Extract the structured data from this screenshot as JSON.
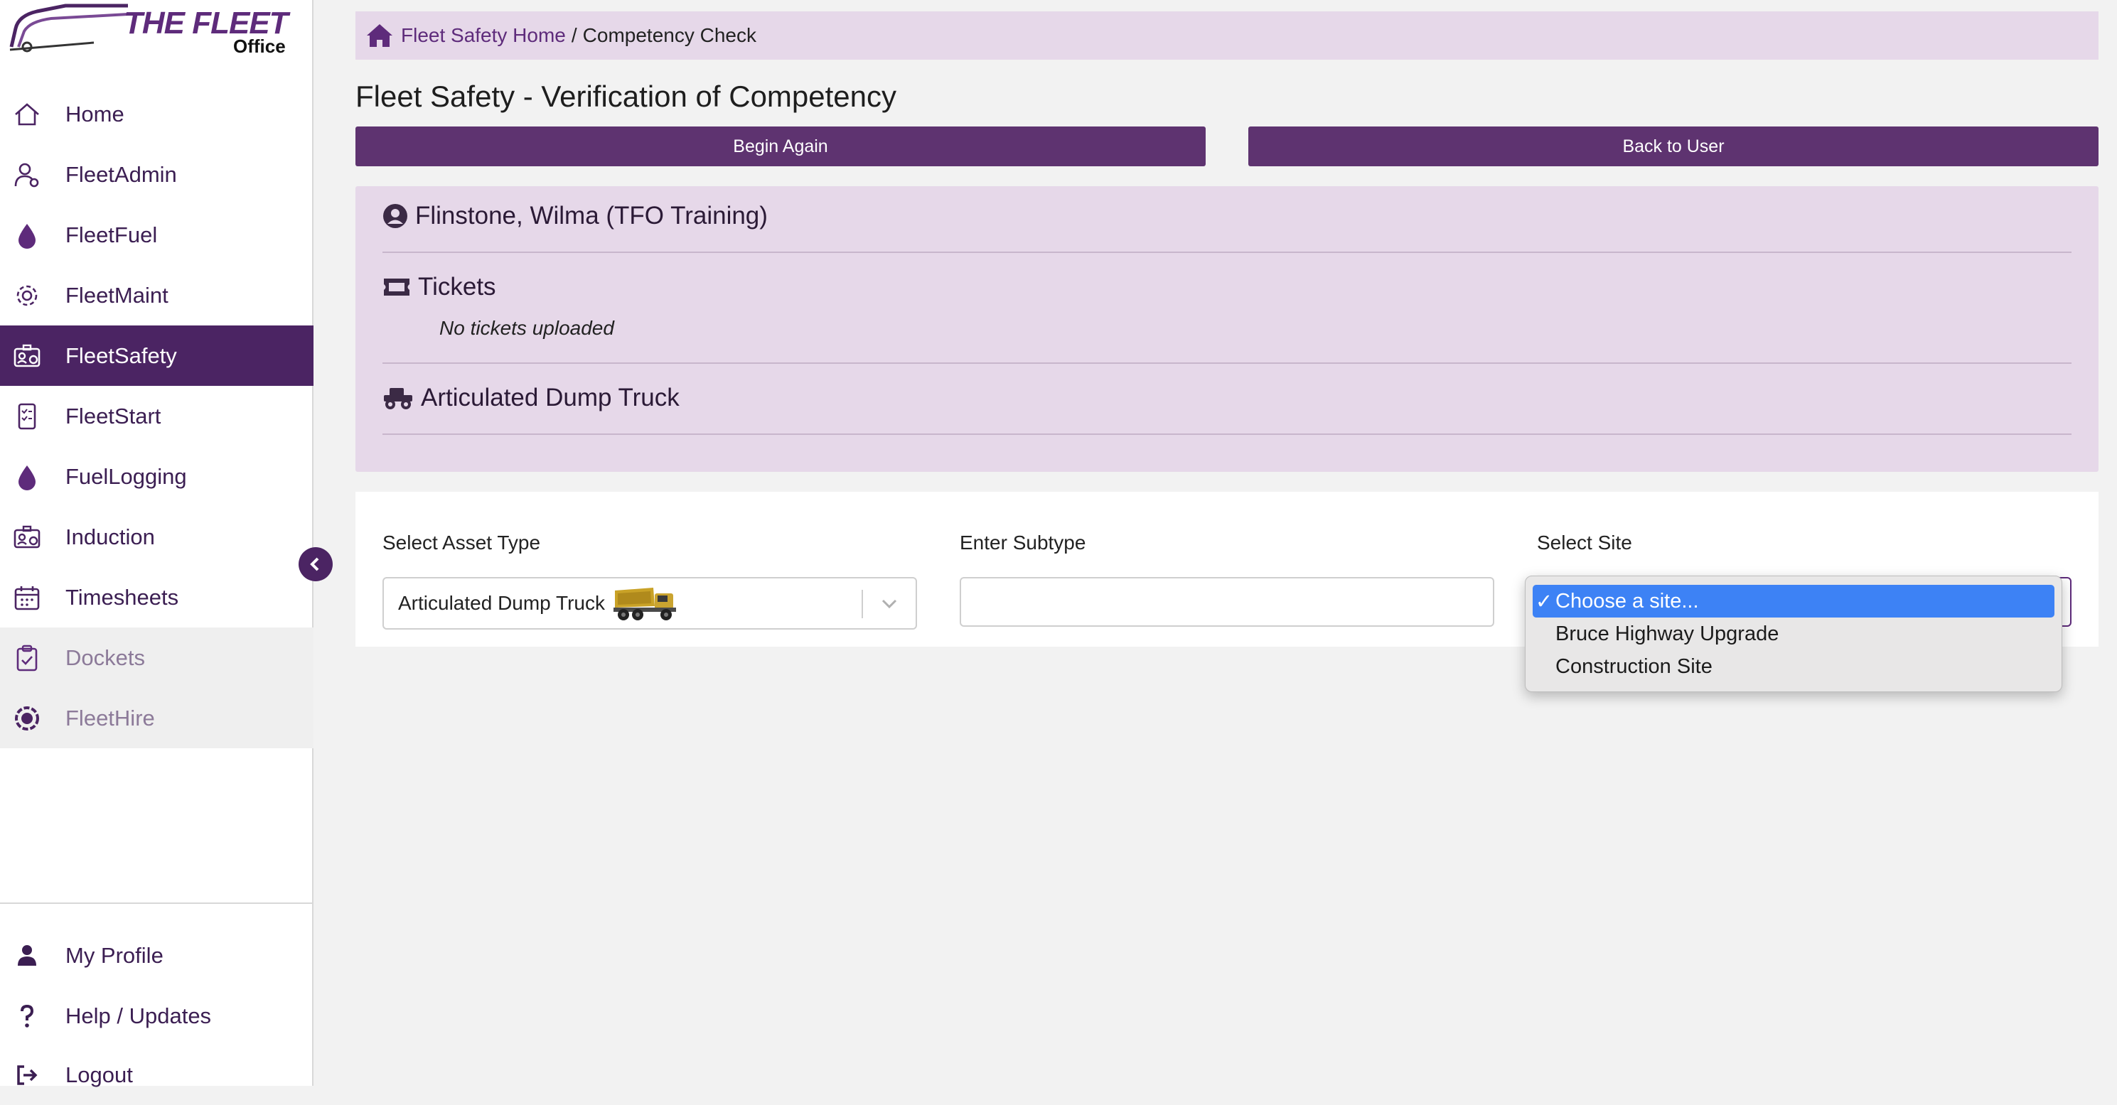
{
  "logo": {
    "wordmark": "THE FLEET",
    "sub": "Office"
  },
  "sidebar": {
    "items": [
      {
        "label": "Home",
        "icon": "home-icon"
      },
      {
        "label": "FleetAdmin",
        "icon": "user-gear-icon"
      },
      {
        "label": "FleetFuel",
        "icon": "fuel-drop-icon"
      },
      {
        "label": "FleetMaint",
        "icon": "gear-icon"
      },
      {
        "label": "FleetSafety",
        "icon": "id-badge-icon",
        "active": true
      },
      {
        "label": "FleetStart",
        "icon": "checklist-phone-icon"
      },
      {
        "label": "FuelLogging",
        "icon": "fuel-drop-icon"
      },
      {
        "label": "Induction",
        "icon": "id-badge-icon"
      },
      {
        "label": "Timesheets",
        "icon": "calendar-icon"
      },
      {
        "label": "Dockets",
        "icon": "clipboard-check-icon",
        "disabled": true
      },
      {
        "label": "FleetHire",
        "icon": "erp-wheel-icon",
        "disabled": true
      }
    ],
    "bottom_items": [
      {
        "label": "My Profile",
        "icon": "user-icon"
      },
      {
        "label": "Help / Updates",
        "icon": "question-icon"
      },
      {
        "label": "Logout",
        "icon": "logout-icon"
      }
    ]
  },
  "breadcrumb": {
    "home_link": "Fleet Safety Home",
    "separator": "/",
    "current": "Competency Check"
  },
  "page": {
    "title": "Fleet Safety - Verification of Competency",
    "begin_again": "Begin Again",
    "back_to_user": "Back to User"
  },
  "info": {
    "user_name": "Flinstone, Wilma (TFO Training)",
    "tickets_heading": "Tickets",
    "tickets_empty": "No tickets uploaded",
    "asset_type": "Articulated Dump Truck"
  },
  "form": {
    "asset_type_label": "Select Asset Type",
    "asset_type_value": "Articulated Dump Truck",
    "subtype_label": "Enter Subtype",
    "subtype_value": "",
    "site_label": "Select Site",
    "site_options": [
      {
        "label": "Choose a site...",
        "selected": true
      },
      {
        "label": "Bruce Highway Upgrade",
        "selected": false
      },
      {
        "label": "Construction Site",
        "selected": false
      }
    ]
  },
  "colors": {
    "brand_purple": "#5e2b7b",
    "sidebar_active": "#4b2463",
    "panel_lilac": "#e6d8e9",
    "dropdown_highlight": "#3d82f5"
  }
}
